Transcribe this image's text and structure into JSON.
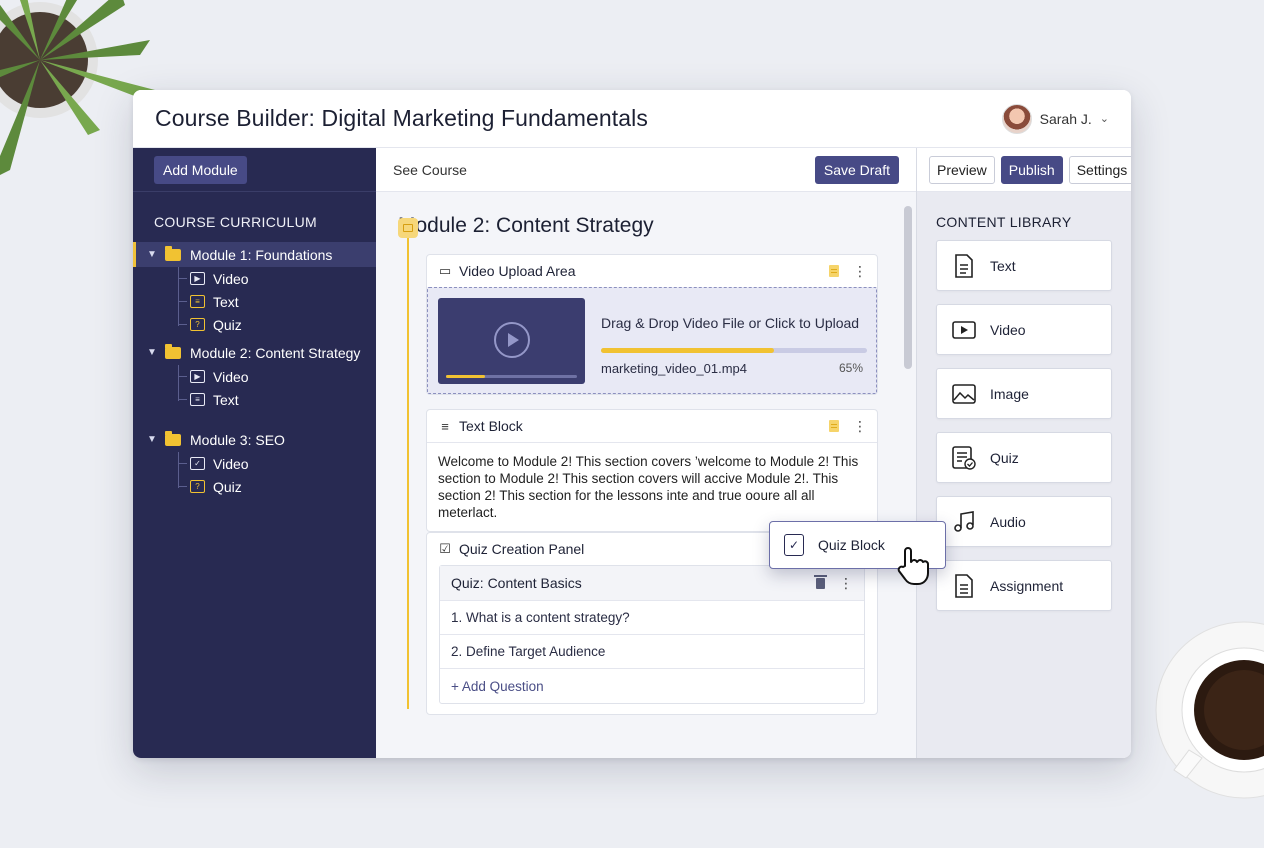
{
  "header": {
    "title": "Course Builder: Digital Marketing Fundamentals",
    "user_name": "Sarah J."
  },
  "sidebar": {
    "add_module_label": "Add Module",
    "curriculum_title": "COURSE CURRICULUM",
    "modules": [
      {
        "label": "Module 1: Foundations",
        "active": true,
        "items": [
          {
            "label": "Video",
            "icon": "video-icon"
          },
          {
            "label": "Text",
            "icon": "text-doc-icon"
          },
          {
            "label": "Quiz",
            "icon": "quiz-icon"
          }
        ]
      },
      {
        "label": "Module 2: Content Strategy",
        "active": false,
        "items": [
          {
            "label": "Video",
            "icon": "video-icon"
          },
          {
            "label": "Text",
            "icon": "text-doc-icon"
          }
        ]
      },
      {
        "label": "Module 3: SEO",
        "active": false,
        "items": [
          {
            "label": "Video",
            "icon": "checkbox-icon"
          },
          {
            "label": "Quiz",
            "icon": "quiz-icon"
          }
        ]
      }
    ]
  },
  "toolbar": {
    "see_course": "See Course",
    "save_draft": "Save Draft",
    "preview": "Preview",
    "publish": "Publish",
    "settings": "Settings"
  },
  "main": {
    "module_title": "Module 2: Content Strategy",
    "video_block": {
      "title": "Video Upload Area",
      "drop_text": "Drag & Drop Video File or Click to Upload",
      "file_name": "marketing_video_01.mp4",
      "progress_label": "65%",
      "progress": 0.65
    },
    "text_block": {
      "title": "Text Block",
      "content": "Welcome to Module 2! This section covers ’welcome to Module 2! This section to Module 2! This section covers will accive Module 2!. This section 2! This section for the lessons inte and true ooure all all meterlact."
    },
    "quiz_block": {
      "title": "Quiz Creation Panel",
      "quiz_name": "Quiz: Content Basics",
      "questions": [
        "1. What is a content strategy?",
        "2. Define Target Audience"
      ],
      "add_question": "+ Add Question"
    }
  },
  "drag_ghost": {
    "label": "Quiz Block"
  },
  "library": {
    "title": "CONTENT LIBRARY",
    "items": [
      {
        "label": "Text",
        "icon": "document-icon"
      },
      {
        "label": "Video",
        "icon": "video-icon"
      },
      {
        "label": "Image",
        "icon": "image-icon"
      },
      {
        "label": "Quiz",
        "icon": "quiz-icon"
      },
      {
        "label": "Audio",
        "icon": "music-note-icon"
      },
      {
        "label": "Assignment",
        "icon": "assignment-icon"
      }
    ]
  },
  "colors": {
    "sidebar_bg": "#282a52",
    "accent": "#474a86",
    "highlight": "#f1c232"
  }
}
